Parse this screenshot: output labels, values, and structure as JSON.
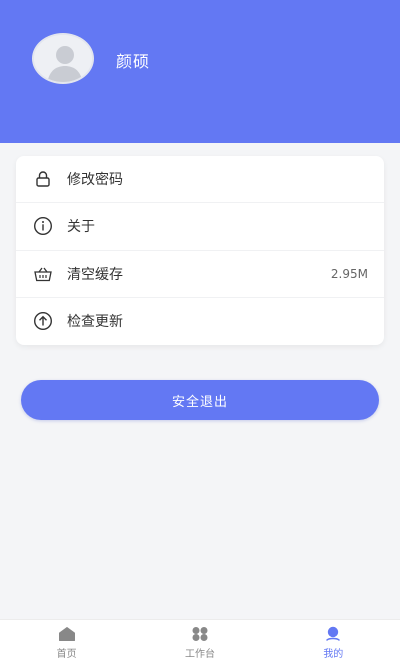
{
  "profile": {
    "name": "颜硕",
    "avatar_icon": "default-user-avatar"
  },
  "menu": {
    "items": [
      {
        "label": "修改密码",
        "icon": "lock-icon",
        "value": ""
      },
      {
        "label": "关于",
        "icon": "info-icon",
        "value": ""
      },
      {
        "label": "清空缓存",
        "icon": "basket-icon",
        "value": "2.95M"
      },
      {
        "label": "检查更新",
        "icon": "arrow-up-circle-icon",
        "value": ""
      }
    ]
  },
  "logout": {
    "label": "安全退出"
  },
  "tabbar": {
    "items": [
      {
        "label": "首页",
        "icon": "home-icon",
        "active": false
      },
      {
        "label": "工作台",
        "icon": "grid-icon",
        "active": false
      },
      {
        "label": "我的",
        "icon": "user-icon",
        "active": true
      }
    ]
  },
  "colors": {
    "primary": "#6378f3",
    "background": "#f4f5f7",
    "inactive_tab": "#888888"
  }
}
